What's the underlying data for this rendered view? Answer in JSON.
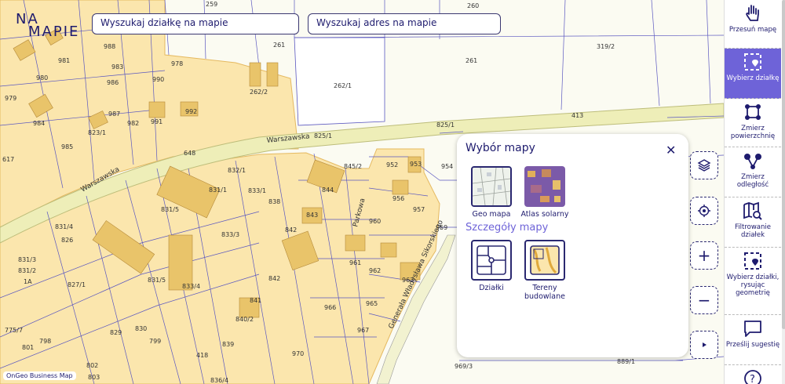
{
  "logo": {
    "line1": "NA",
    "line2": "MAPIE"
  },
  "search": {
    "parcel_placeholder": "Wyszukaj działkę na mapie",
    "address_placeholder": "Wyszukaj adres na mapie"
  },
  "right_bar": {
    "items": [
      {
        "label": "Przesuń mapę",
        "icon": "hand-icon"
      },
      {
        "label": "Wybierz działkę",
        "icon": "select-parcel-icon",
        "active": true
      },
      {
        "label": "Zmierz powierzchnię",
        "icon": "measure-area-icon"
      },
      {
        "label": "Zmierz odległość",
        "icon": "measure-distance-icon"
      },
      {
        "label": "Filtrowanie działek",
        "icon": "filter-map-icon"
      },
      {
        "label": "Wybierz działki, rysując geometrię",
        "icon": "draw-geometry-icon"
      },
      {
        "label": "Prześlij sugestię",
        "icon": "chat-icon"
      },
      {
        "label": "",
        "icon": "help-icon"
      }
    ]
  },
  "controls": {
    "layers_icon": "layers-icon",
    "locate_icon": "locate-icon",
    "zoom_in": "+",
    "zoom_out": "−",
    "expand_icon": "play-icon"
  },
  "panel": {
    "title": "Wybór mapy",
    "close": "✕",
    "base_maps": [
      {
        "label": "Geo mapa",
        "selected": true
      },
      {
        "label": "Atlas solarny",
        "selected": false
      }
    ],
    "details_title": "Szczegóły mapy",
    "detail_layers": [
      {
        "label": "Działki",
        "selected": true
      },
      {
        "label": "Tereny budowlane",
        "selected": true
      }
    ]
  },
  "map": {
    "streets": [
      "Warszawska",
      "Warszawska",
      "Parkowa",
      "Generała Władysława Sikorskiego"
    ],
    "plots": [
      "259",
      "260",
      "319/2",
      "261",
      "261",
      "262/1",
      "262/2",
      "978",
      "981",
      "988",
      "983",
      "980",
      "986",
      "990",
      "979",
      "987",
      "992",
      "984",
      "991",
      "982",
      "823/1",
      "985",
      "617",
      "648",
      "832/1",
      "831/1",
      "833/1",
      "838",
      "844",
      "843",
      "842",
      "952",
      "953",
      "954",
      "956",
      "957",
      "959",
      "960",
      "961",
      "962",
      "963",
      "965",
      "966",
      "967",
      "831/5",
      "831/4",
      "826",
      "831/3",
      "827/1",
      "831/2",
      "833/3",
      "833/4",
      "831/5",
      "841",
      "840/2",
      "839",
      "842",
      "970",
      "969/3",
      "889/1",
      "1A",
      "798",
      "775/7",
      "801",
      "802",
      "803",
      "836/4",
      "418",
      "413",
      "825/1",
      "825/1",
      "845/2",
      "799",
      "829",
      "830"
    ]
  },
  "attribution": "OnGeo Business Map",
  "colors": {
    "accent": "#6e63d8",
    "navy": "#1e1b6e",
    "zone": "#fbe6ad",
    "plot_line": "#5a57c0",
    "road": "#eeeeb8"
  }
}
